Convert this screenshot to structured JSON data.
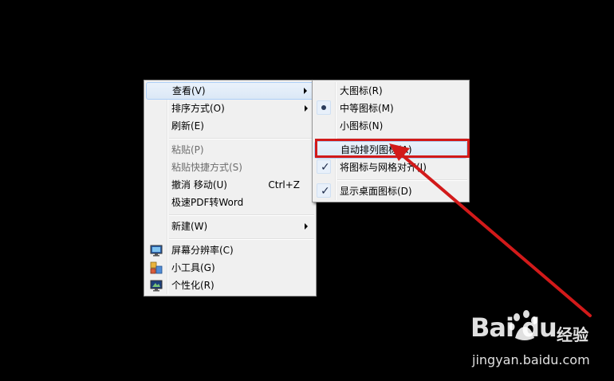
{
  "context_menu": {
    "items": [
      {
        "label": "查看(V)",
        "submenu": true,
        "hover": true
      },
      {
        "label": "排序方式(O)",
        "submenu": true
      },
      {
        "label": "刷新(E)"
      },
      {
        "label": "粘贴(P)",
        "disabled": true
      },
      {
        "label": "粘贴快捷方式(S)",
        "disabled": true
      },
      {
        "label": "撤消 移动(U)",
        "shortcut": "Ctrl+Z"
      },
      {
        "label": "极速PDF转Word"
      },
      {
        "label": "新建(W)",
        "submenu": true
      },
      {
        "label": "屏幕分辨率(C)",
        "icon": "screen-resolution-icon"
      },
      {
        "label": "小工具(G)",
        "icon": "gadgets-icon"
      },
      {
        "label": "个性化(R)",
        "icon": "personalize-icon"
      }
    ]
  },
  "view_submenu": {
    "items": [
      {
        "label": "大图标(R)"
      },
      {
        "label": "中等图标(M)",
        "state": "selected-radio"
      },
      {
        "label": "小图标(N)"
      },
      {
        "label": "自动排列图标(A)",
        "hover": true
      },
      {
        "label": "将图标与网格对齐(I)",
        "state": "checked"
      },
      {
        "label": "显示桌面图标(D)",
        "state": "checked"
      }
    ]
  },
  "annotation": {
    "color": "#d21a1a"
  },
  "watermark": {
    "logo": "Bai du",
    "jingyan": "经验",
    "url": "jingyan.baidu.com"
  }
}
